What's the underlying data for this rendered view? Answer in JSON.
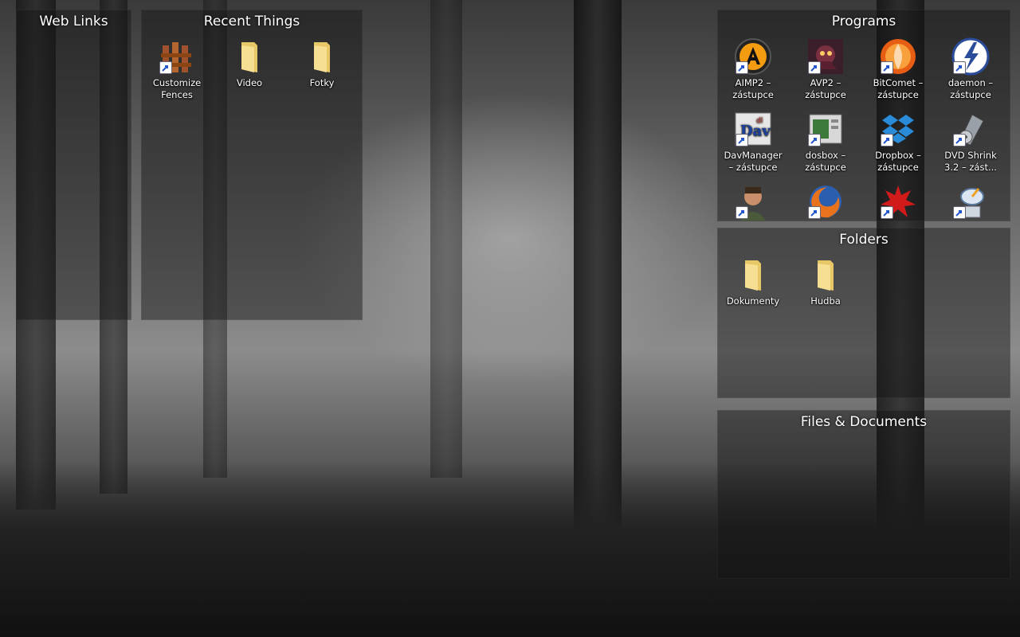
{
  "fences": {
    "web_links": {
      "title": "Web Links"
    },
    "recent": {
      "title": "Recent Things",
      "items": [
        {
          "label": "Customize Fences",
          "icon": "fences-icon"
        },
        {
          "label": "Video",
          "icon": "folder-icon"
        },
        {
          "label": "Fotky",
          "icon": "folder-icon"
        }
      ]
    },
    "programs": {
      "title": "Programs",
      "items": [
        {
          "label": "AIMP2 – zástupce",
          "icon": "aimp-icon"
        },
        {
          "label": "AVP2 – zástupce",
          "icon": "avp-icon"
        },
        {
          "label": "BitComet – zástupce",
          "icon": "bitcomet-icon"
        },
        {
          "label": "daemon – zástupce",
          "icon": "daemon-tools-icon"
        },
        {
          "label": "DavManager – zástupce",
          "icon": "davmanager-icon"
        },
        {
          "label": "dosbox – zástupce",
          "icon": "dosbox-icon"
        },
        {
          "label": "Dropbox – zástupce",
          "icon": "dropbox-icon"
        },
        {
          "label": "DVD Shrink 3.2 – zást...",
          "icon": "dvdshrink-icon"
        },
        {
          "label": "",
          "icon": "game-character-icon"
        },
        {
          "label": "",
          "icon": "firefox-icon"
        },
        {
          "label": "",
          "icon": "red-splat-icon"
        },
        {
          "label": "",
          "icon": "satellite-icon"
        }
      ]
    },
    "folders": {
      "title": "Folders",
      "items": [
        {
          "label": "Dokumenty",
          "icon": "folder-icon"
        },
        {
          "label": "Hudba",
          "icon": "folder-icon"
        }
      ]
    },
    "files": {
      "title": "Files & Documents"
    }
  },
  "colors": {
    "fence_bg": "#141414",
    "text": "#ffffff",
    "folder": "#f2d680"
  }
}
